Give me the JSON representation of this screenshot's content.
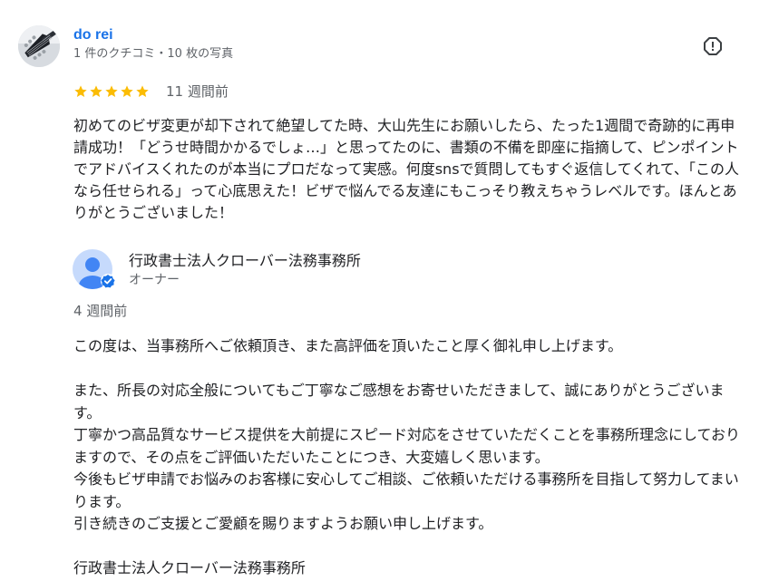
{
  "review": {
    "author_name": "do rei",
    "author_meta": "1 件のクチコミ・10 枚の写真",
    "rating": 5,
    "rating_max": 5,
    "star_color": "#fbbc04",
    "age": "11 週間前",
    "text": "初めてのビザ変更が却下されて絶望してた時、大山先生にお願いしたら、たった1週間で奇跡的に再申請成功！「どうせ時間かかるでしょ…」と思ってたのに、書類の不備を即座に指摘して、ピンポイントでアドバイスくれたのが本当にプロだなって実感。何度snsで質問してもすぐ返信してくれて、「この人なら任せられる」って心底思えた！ビザで悩んでる友達にもこっそり教えちゃうレベルです。ほんとありがとうございました！",
    "report_icon": "report-flag-icon"
  },
  "reply": {
    "owner_name": "行政書士法人クローバー法務事務所",
    "owner_role": "オーナー",
    "verified_icon": "verified-check-icon",
    "age": "4 週間前",
    "text": "この度は、当事務所へご依頼頂き、また高評価を頂いたこと厚く御礼申し上げます。\n\nまた、所長の対応全般についてもご丁寧なご感想をお寄せいただきまして、誠にありがとうございます。\n丁寧かつ高品質なサービス提供を大前提にスピード対応をさせていただくことを事務所理念にしておりますので、その点をご評価いただいたことにつき、大変嬉しく思います。\n今後もビザ申請でお悩みのお客様に安心してご相談、ご依頼いただける事務所を目指して努力してまいります。\n引き続きのご支援とご愛顧を賜りますようお願い申し上げます。\n\n行政書士法人クローバー法務事務所"
  },
  "colors": {
    "link": "#1a73e8",
    "secondary_text": "#5f6368",
    "primary_text": "#202124",
    "verified_badge": "#1a73e8"
  }
}
